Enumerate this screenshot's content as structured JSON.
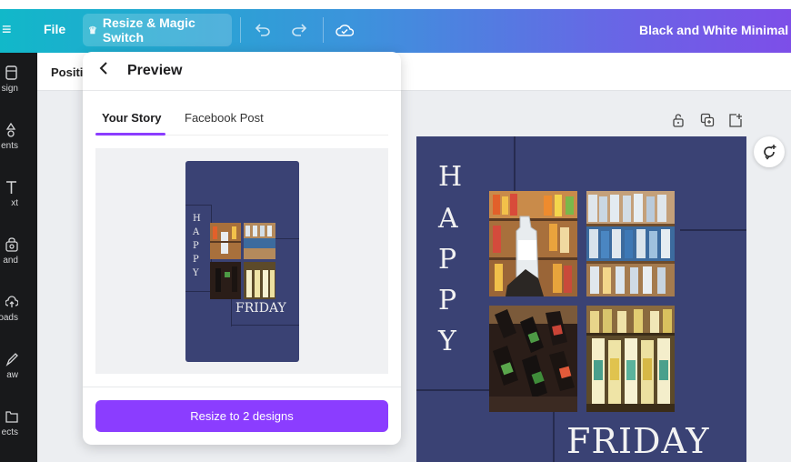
{
  "topbar": {
    "file_label": "File",
    "magic_label": "Resize & Magic Switch",
    "doc_title": "Black and White Minimal Ne"
  },
  "sidebar": {
    "items": [
      {
        "label": "sign",
        "icon": "template-icon"
      },
      {
        "label": "ents",
        "icon": "elements-icon"
      },
      {
        "label": "xt",
        "icon": "text-icon"
      },
      {
        "label": "and",
        "icon": "brand-icon"
      },
      {
        "label": "oads",
        "icon": "uploads-icon"
      },
      {
        "label": "aw",
        "icon": "draw-icon"
      },
      {
        "label": "ects",
        "icon": "projects-icon"
      }
    ]
  },
  "toolbar": {
    "position_label": "Positi"
  },
  "preview_panel": {
    "title": "Preview",
    "tabs": [
      {
        "label": "Your Story",
        "active": true
      },
      {
        "label": "Facebook Post",
        "active": false
      }
    ],
    "resize_button": "Resize to 2 designs"
  },
  "design": {
    "letters": [
      "H",
      "A",
      "P",
      "P",
      "Y"
    ],
    "bottom_text": "FRIDAY",
    "background_color": "#3a4274"
  },
  "colors": {
    "accent": "#8b3dff",
    "sidebar_bg": "#18191b"
  }
}
